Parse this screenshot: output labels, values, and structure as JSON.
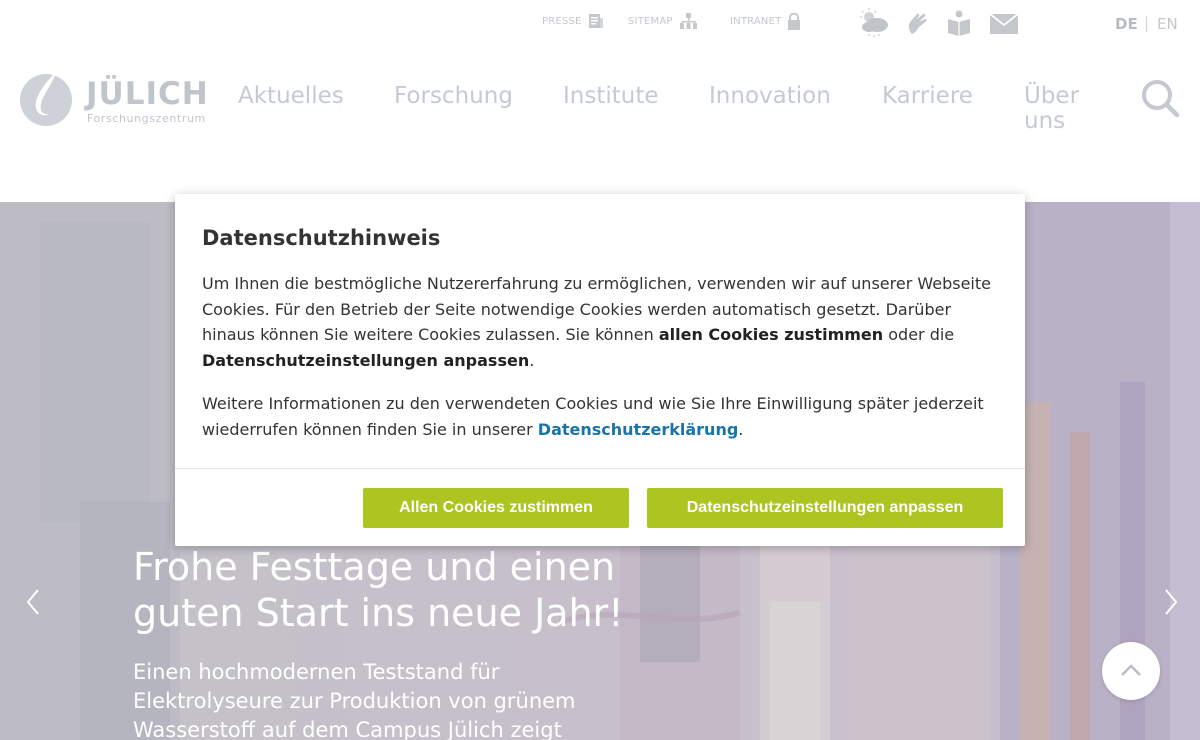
{
  "utility": {
    "presse": "PRESSE",
    "sitemap": "SITEMAP",
    "intranet": "INTRANET"
  },
  "icons": {
    "weather": "weather-cloud-icon",
    "sign_language": "sign-language-icon",
    "easy_language": "book-icon",
    "contact": "mail-icon"
  },
  "languages": {
    "de": "DE",
    "separator": "|",
    "en": "EN"
  },
  "logo": {
    "name": "JÜLICH",
    "subtitle": "Forschungszentrum"
  },
  "nav": {
    "items": [
      "Aktuelles",
      "Forschung",
      "Institute",
      "Innovation",
      "Karriere",
      "Über uns"
    ]
  },
  "hero": {
    "title": "Frohe Festtage und einen guten Start ins neue Jahr!",
    "text": "Einen hochmodernen Teststand für Elektrolyseure zur Produktion von grünem Wasserstoff auf dem Campus Jülich zeigt"
  },
  "modal": {
    "title": "Datenschutzhinweis",
    "p1_text1": "Um Ihnen die bestmögliche Nutzererfahrung zu ermöglichen, verwenden wir auf unserer Webseite Cookies. Für den Betrieb der Seite notwendige Cookies werden automatisch gesetzt. Darüber hinaus können Sie weitere Cookies zulassen. Sie können ",
    "p1_bold1": "allen Cookies zustimmen",
    "p1_text2": " oder die ",
    "p1_bold2": "Datenschutzeinstellungen anpassen",
    "p1_text3": ".",
    "p2_text1": "Weitere Informationen zu den verwendeten Cookies und wie Sie Ihre Einwilligung später jederzeit wiederrufen können finden Sie in unserer ",
    "p2_link": "Datenschutzerklärung",
    "p2_text2": ".",
    "accept_button": "Allen Cookies zustimmen",
    "settings_button": "Datenschutzeinstellungen anpassen"
  },
  "colors": {
    "accent_green": "#adc520",
    "link_blue": "#1a74a8"
  }
}
